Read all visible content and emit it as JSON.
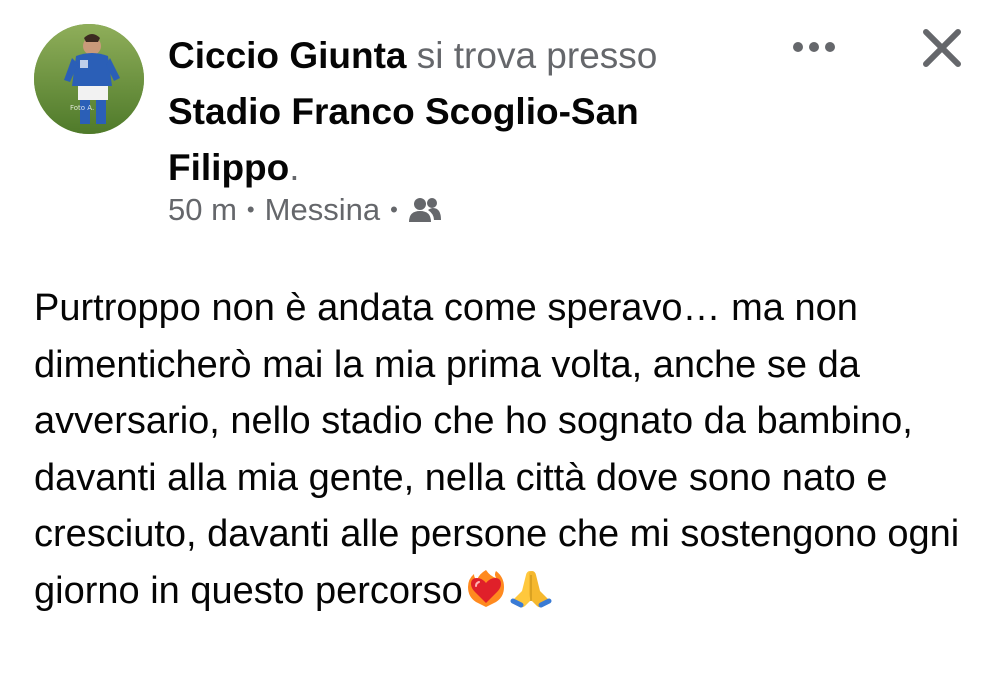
{
  "post": {
    "author_name": "Ciccio Giunta",
    "action_text": "si trova presso",
    "place_name": "Stadio Franco Scoglio-San Filippo",
    "place_suffix": ".",
    "timestamp": "50 m",
    "separator": "•",
    "location": "Messina",
    "audience_icon": "friends-icon",
    "body_text": "Purtroppo non è andata come speravo… ma non dimenticherò mai la mia prima volta, anche se da avversario, nello stadio che ho sognato da bambino, davanti alla mia gente, nella città dove sono nato e cresciuto, davanti alle persone che mi sostengono ogni giorno in questo percorso",
    "emojis": [
      "heart-on-fire-emoji",
      "folded-hands-emoji"
    ]
  },
  "icons": {
    "more": "more-options-icon",
    "close": "close-icon"
  },
  "colors": {
    "primary_text": "#050505",
    "secondary_text": "#65676b",
    "background": "#ffffff"
  }
}
